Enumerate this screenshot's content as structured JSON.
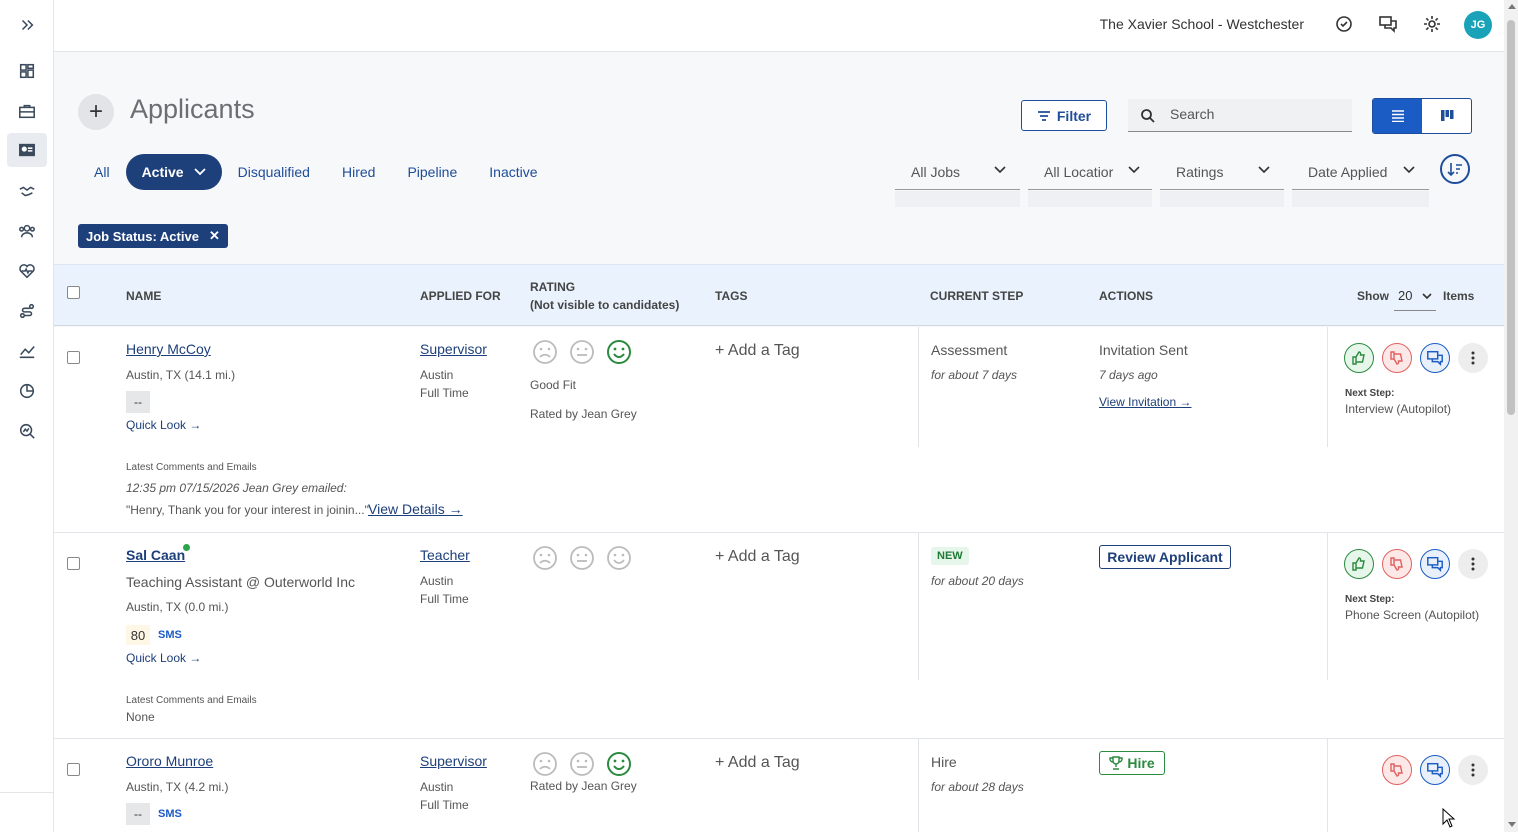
{
  "org_name": "The Xavier School - Westchester",
  "user_initials": "JG",
  "page_title": "Applicants",
  "filter_label": "Filter",
  "search_placeholder": "Search",
  "tabs": [
    "All",
    "Active",
    "Disqualified",
    "Hired",
    "Pipeline",
    "Inactive"
  ],
  "active_tab": "Active",
  "dropdowns": [
    "All Jobs",
    "All Locatior",
    "Ratings",
    "Date Applied"
  ],
  "chip": "Job Status: Active",
  "table": {
    "headers": {
      "name": "NAME",
      "applied_for": "APPLIED FOR",
      "rating": "RATING",
      "rating_sub": "(Not visible to candidates)",
      "tags": "TAGS",
      "current_step": "CURRENT STEP",
      "actions": "ACTIONS"
    },
    "show_label": "Show",
    "show_value": "20",
    "items_label": "Items"
  },
  "common": {
    "quick_look": "Quick Look →",
    "add_tag": "+ Add a Tag",
    "latest_comments": "Latest Comments and Emails",
    "next_step": "Next Step:",
    "sms": "SMS"
  },
  "rows": [
    {
      "name": "Henry McCoy",
      "location": "Austin, TX (14.1 mi.)",
      "badge": "--",
      "job": "Supervisor",
      "job_location": "Austin",
      "job_type": "Full Time",
      "rating_selected": "happy",
      "rating_label": "Good Fit",
      "rated_by": "Rated by Jean Grey",
      "step": "Assessment",
      "step_duration": "for about 7 days",
      "action_title": "Invitation Sent",
      "action_time": "7 days ago",
      "action_link": "View Invitation →",
      "next_step": "Interview (Autopilot)",
      "comment_meta": "12:35 pm 07/15/2026 Jean Grey emailed:",
      "comment_text": "\"Henry, Thank you for your interest in joinin...\"",
      "comment_link": "View Details →"
    },
    {
      "name": "Sal Caan",
      "headline": "Teaching Assistant @ Outerworld Inc",
      "location": "Austin, TX (0.0 mi.)",
      "score": "80",
      "job": "Teacher",
      "job_location": "Austin",
      "job_type": "Full Time",
      "step_badge": "NEW",
      "step_duration": "for about 20 days",
      "action_button": "Review Applicant",
      "next_step": "Phone Screen (Autopilot)",
      "comment_text": "None"
    },
    {
      "name": "Ororo Munroe",
      "location": "Austin, TX (4.2 mi.)",
      "badge": "--",
      "job": "Supervisor",
      "job_location": "Austin",
      "job_type": "Full Time",
      "rating_selected": "happy",
      "rated_by": "Rated by Jean Grey",
      "step": "Hire",
      "step_duration": "for about 28 days",
      "action_button": "Hire"
    }
  ]
}
